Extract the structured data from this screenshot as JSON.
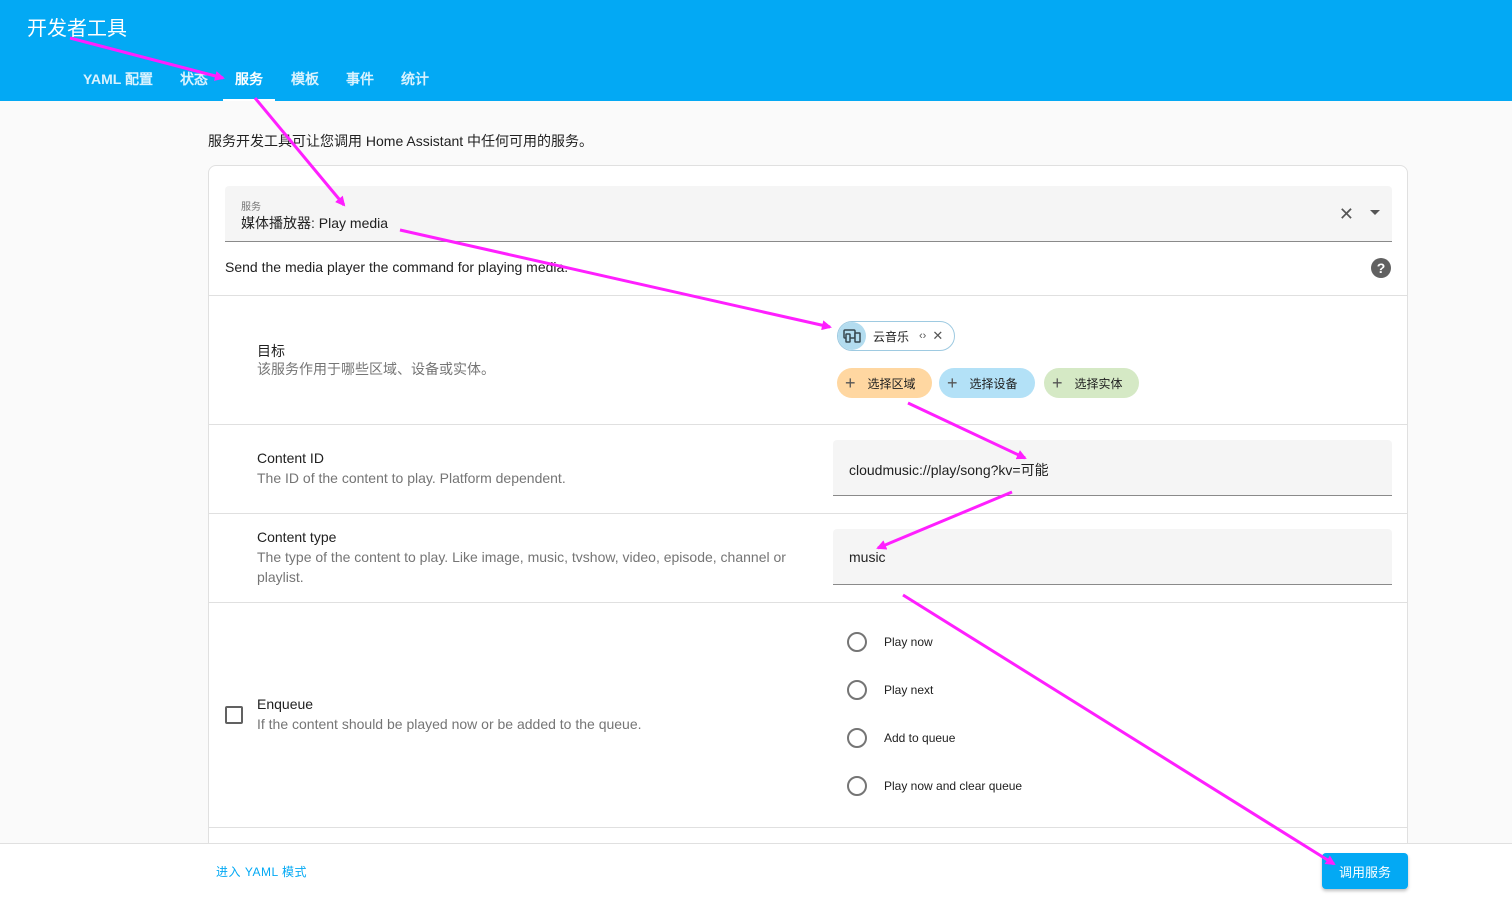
{
  "header": {
    "title": "开发者工具",
    "tabs": [
      {
        "label": "YAML 配置"
      },
      {
        "label": "状态"
      },
      {
        "label": "服务"
      },
      {
        "label": "模板"
      },
      {
        "label": "事件"
      },
      {
        "label": "统计"
      }
    ],
    "active_tab": "服务"
  },
  "intro": "服务开发工具可让您调用 Home Assistant 中任何可用的服务。",
  "service": {
    "label": "服务",
    "value": "媒体播放器: Play media",
    "description": "Send the media player the command for playing media.",
    "help": "?"
  },
  "target": {
    "title": "目标",
    "subtitle": "该服务作用于哪些区域、设备或实体。",
    "selected_device": "云音乐",
    "expand_glyph": "‹›",
    "remove_glyph": "✕",
    "add_buttons": [
      {
        "label": "选择区域",
        "color": "#ffd7a1"
      },
      {
        "label": "选择设备",
        "color": "#b3e1f7"
      },
      {
        "label": "选择实体",
        "color": "#d5e9c5"
      }
    ]
  },
  "content_id": {
    "title": "Content ID",
    "subtitle": "The ID of the content to play. Platform dependent.",
    "value": "cloudmusic://play/song?kv=可能"
  },
  "content_type": {
    "title": "Content type",
    "subtitle": "The type of the content to play. Like image, music, tvshow, video, episode, channel or playlist.",
    "value": "music"
  },
  "enqueue": {
    "title": "Enqueue",
    "subtitle": "If the content should be played now or be added to the queue.",
    "options": [
      {
        "label": "Play now"
      },
      {
        "label": "Play next"
      },
      {
        "label": "Add to queue"
      },
      {
        "label": "Play now and clear queue"
      }
    ]
  },
  "footer": {
    "yaml_mode": "进入 YAML 模式",
    "call_service": "调用服务"
  },
  "colors": {
    "primary": "#03a9f4",
    "annotation": "#ff1fff"
  }
}
